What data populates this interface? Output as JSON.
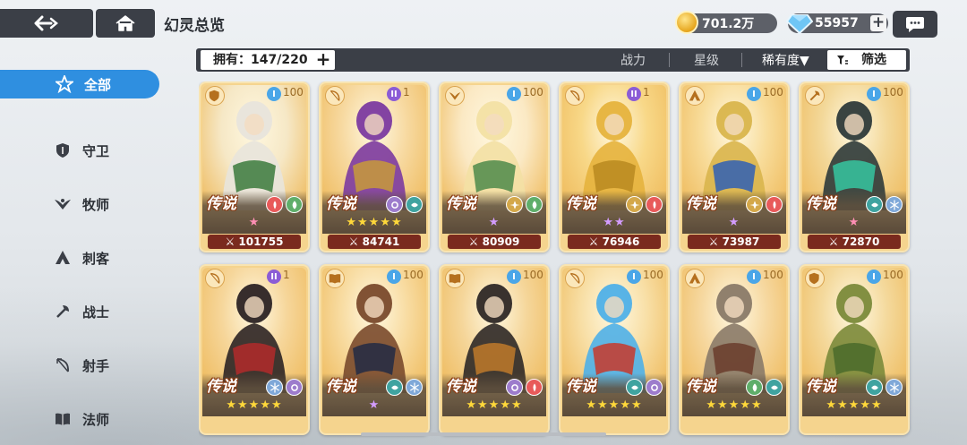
{
  "header": {
    "title": "幻灵总览",
    "gold": "701.2万",
    "gems": "55957"
  },
  "sidebar": {
    "items": [
      {
        "label": "全部",
        "icon": "star-all-icon",
        "active": true
      },
      {
        "label": "守卫",
        "icon": "shield-icon",
        "active": false
      },
      {
        "label": "牧师",
        "icon": "wings-icon",
        "active": false
      },
      {
        "label": "刺客",
        "icon": "hood-icon",
        "active": false
      },
      {
        "label": "战士",
        "icon": "axe-icon",
        "active": false
      },
      {
        "label": "射手",
        "icon": "bow-icon",
        "active": false
      },
      {
        "label": "法师",
        "icon": "book-icon",
        "active": false
      }
    ]
  },
  "filterbar": {
    "owned": "拥有：147/220",
    "sort_power": "战力",
    "sort_star": "星级",
    "sort_rarity": "稀有度▼",
    "filter": "筛选"
  },
  "cards": [
    {
      "rarity": "传说",
      "level": "100",
      "power": "101755",
      "class_icon": "shield-icon",
      "gen": "I",
      "gen_color": "#4aa6e8",
      "stars": "★",
      "star_color": "pink",
      "elements": [
        "fire-element-icon",
        "nature-element-icon"
      ],
      "art": "#f6e8c6",
      "figure": "#e8e4dc",
      "accent": "#3b7a3c"
    },
    {
      "rarity": "传说",
      "level": "1",
      "power": "84741",
      "class_icon": "bow-icon",
      "gen": "II",
      "gen_color": "#8b5cd6",
      "stars": "★★★★★",
      "star_color": "gold",
      "elements": [
        "void-element-icon",
        "water-element-icon"
      ],
      "art": "#f7d9a0",
      "figure": "#7c3aa0",
      "accent": "#c89a3a"
    },
    {
      "rarity": "传说",
      "level": "100",
      "power": "80909",
      "class_icon": "wings-icon",
      "gen": "I",
      "gen_color": "#4aa6e8",
      "stars": "★",
      "star_color": "purple",
      "elements": [
        "light-element-icon",
        "nature-element-icon"
      ],
      "art": "#fbe9c4",
      "figure": "#f3e0a4",
      "accent": "#4e8a4a"
    },
    {
      "rarity": "传说",
      "level": "1",
      "power": "76946",
      "class_icon": "bow-icon",
      "gen": "II",
      "gen_color": "#8b5cd6",
      "stars": "★★",
      "star_color": "purple",
      "elements": [
        "light-element-icon",
        "fire-element-icon"
      ],
      "art": "#f8d888",
      "figure": "#e6b33d",
      "accent": "#b88a20"
    },
    {
      "rarity": "传说",
      "level": "100",
      "power": "73987",
      "class_icon": "hood-icon",
      "gen": "I",
      "gen_color": "#4aa6e8",
      "stars": "★",
      "star_color": "purple",
      "elements": [
        "light-element-icon",
        "fire-element-icon"
      ],
      "art": "#f8dc9a",
      "figure": "#d9b54c",
      "accent": "#2f5fb5"
    },
    {
      "rarity": "传说",
      "level": "100",
      "power": "72870",
      "class_icon": "axe-icon",
      "gen": "I",
      "gen_color": "#4aa6e8",
      "stars": "★",
      "star_color": "pink",
      "elements": [
        "water-element-icon",
        "ice-element-icon"
      ],
      "art": "#f3d899",
      "figure": "#2e3a3a",
      "accent": "#36c5a0"
    },
    {
      "rarity": "传说",
      "level": "1",
      "power": "",
      "class_icon": "bow-icon",
      "gen": "II",
      "gen_color": "#8b5cd6",
      "stars": "★★★★★",
      "star_color": "gold",
      "elements": [
        "ice-element-icon",
        "void-element-icon"
      ],
      "art": "#f6d69a",
      "figure": "#2c2324",
      "accent": "#b32a2a"
    },
    {
      "rarity": "传说",
      "level": "100",
      "power": "",
      "class_icon": "book-icon",
      "gen": "I",
      "gen_color": "#4aa6e8",
      "stars": "★",
      "star_color": "purple",
      "elements": [
        "water-element-icon",
        "ice-element-icon"
      ],
      "art": "#f8dca2",
      "figure": "#7a4a2c",
      "accent": "#222a44"
    },
    {
      "rarity": "传说",
      "level": "100",
      "power": "",
      "class_icon": "book-icon",
      "gen": "I",
      "gen_color": "#4aa6e8",
      "stars": "★★★★★",
      "star_color": "gold",
      "elements": [
        "void-element-icon",
        "fire-element-icon"
      ],
      "art": "#f5d69a",
      "figure": "#2e2826",
      "accent": "#c07a2a"
    },
    {
      "rarity": "传说",
      "level": "100",
      "power": "",
      "class_icon": "bow-icon",
      "gen": "I",
      "gen_color": "#4aa6e8",
      "stars": "★★★★★",
      "star_color": "gold",
      "elements": [
        "water-element-icon",
        "void-element-icon"
      ],
      "art": "#f8dfa6",
      "figure": "#4fb0e8",
      "accent": "#c8382a"
    },
    {
      "rarity": "传说",
      "level": "100",
      "power": "",
      "class_icon": "hood-icon",
      "gen": "I",
      "gen_color": "#4aa6e8",
      "stars": "★★★★★",
      "star_color": "gold",
      "elements": [
        "nature-element-icon",
        "water-element-icon"
      ],
      "art": "#f6d8a0",
      "figure": "#8a7a68",
      "accent": "#6a3c2c"
    },
    {
      "rarity": "传说",
      "level": "100",
      "power": "",
      "class_icon": "shield-icon",
      "gen": "I",
      "gen_color": "#4aa6e8",
      "stars": "★★★★★",
      "star_color": "gold",
      "elements": [
        "water-element-icon",
        "ice-element-icon"
      ],
      "art": "#f4d99c",
      "figure": "#7b8a3a",
      "accent": "#4a6a2a"
    }
  ]
}
